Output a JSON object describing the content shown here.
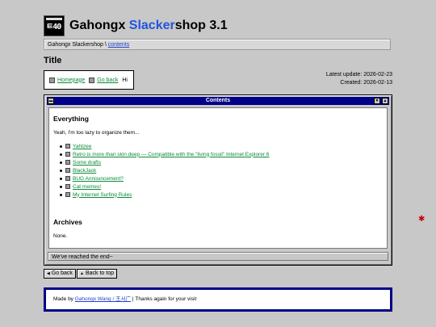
{
  "logo": {
    "text": "ㅌ40"
  },
  "site": {
    "title_prefix": "Gahongx ",
    "title_accent": "Slacker",
    "title_suffix": "shop 3.1"
  },
  "breadcrumb": {
    "site": "Gahongx Slackershop",
    "separator": " \\ ",
    "current": "contents"
  },
  "page": {
    "title": "Title"
  },
  "nav": {
    "homepage": "Homepage",
    "go_back": "Go back",
    "hi": "Hi"
  },
  "dates": {
    "latest_update": "Latest update: 2026-02-23",
    "created": "Created: 2026-02-13"
  },
  "window": {
    "title": "Contents",
    "menu_icon": "▬",
    "down_icon": "▼",
    "up_icon": "▲",
    "status": "We've reached the end~"
  },
  "everything": {
    "heading": "Everything",
    "intro": "Yeah, I'm too lazy to organize them...",
    "items": [
      "Yahtzee",
      "Retro is more than skin deep — Compatible with the \"living fossil\" Internet Explorer 6",
      "Some drafts",
      "BlackJack",
      "BUG Announcement?",
      "Cat memes!",
      "My Internet Surfing Rules"
    ]
  },
  "archives": {
    "heading": "Archives",
    "text": "None."
  },
  "buttons": {
    "go_back": "Go back",
    "back_to_top": "Back to top",
    "left_arrow": "◀",
    "up_arrow": "▲"
  },
  "footer": {
    "made_by": "Made by ",
    "author": "Gahongx Wang / 王서广",
    "thanks": " | Thanks again for your visit"
  },
  "decor": {
    "bug_icon": "✱"
  }
}
